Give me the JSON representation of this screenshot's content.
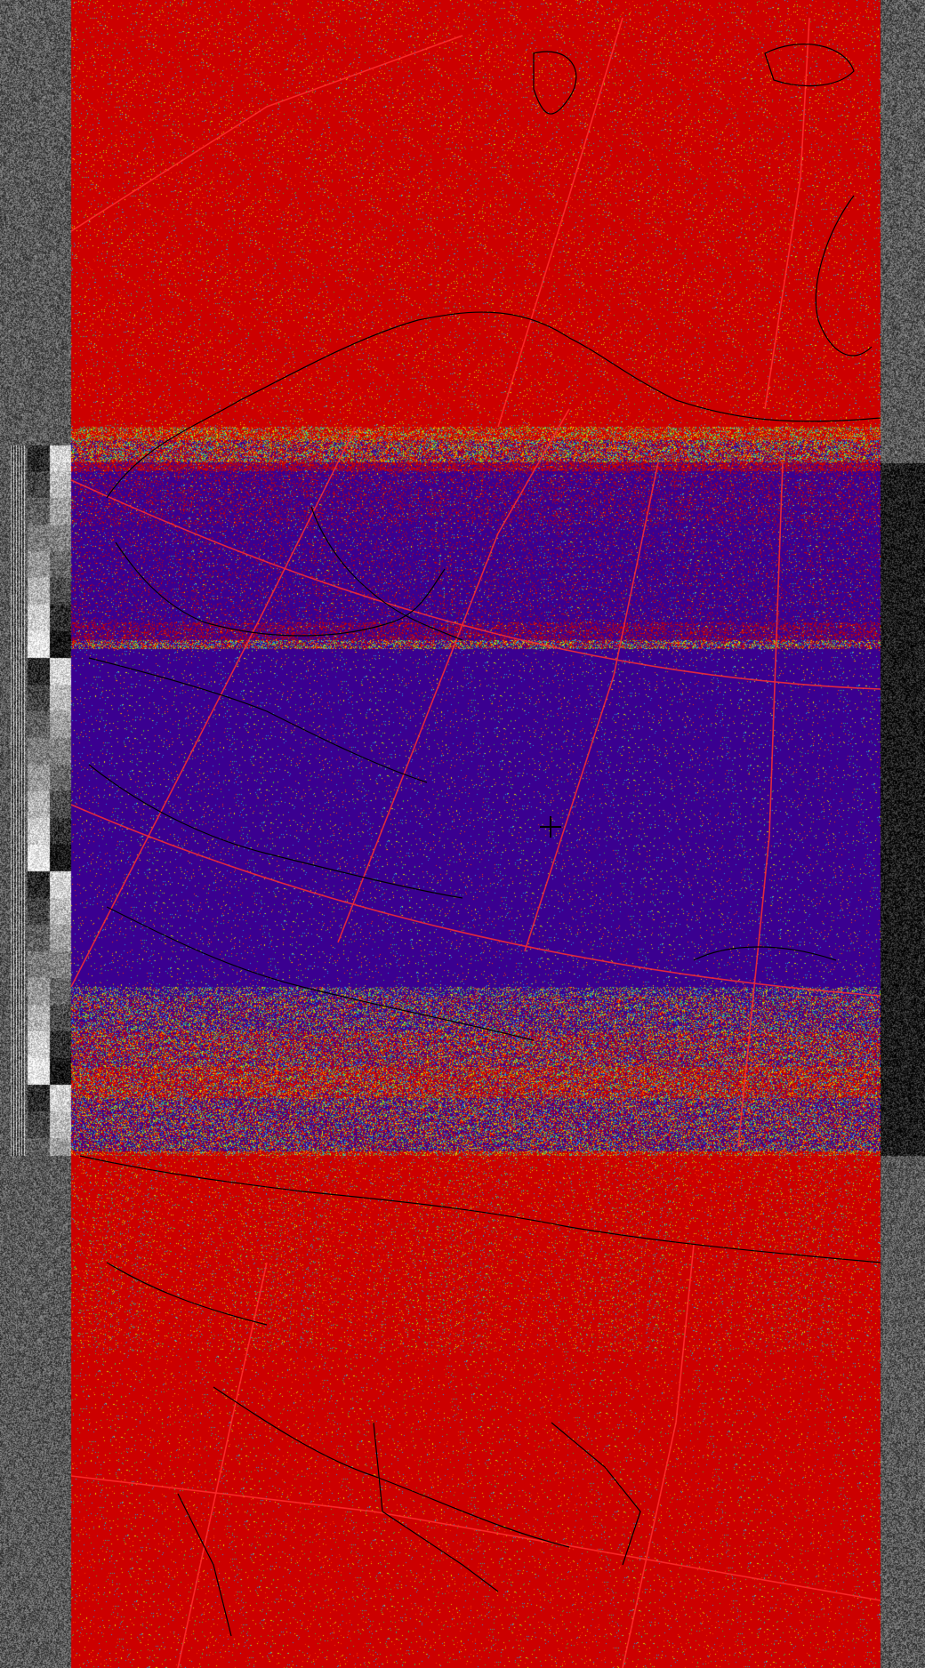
{
  "image": {
    "kind": "weather-satellite-image",
    "palette": {
      "background_red": "#cc0000",
      "cloud_indigo": "#3a0090",
      "speckle_colors": [
        "#e0e000",
        "#40c040",
        "#20a0e0",
        "#ff4000"
      ],
      "coastline": "#000000",
      "graticule": "#ff2020",
      "sync_noise": "#808080"
    },
    "center_marker_icon": "crosshair-icon"
  }
}
